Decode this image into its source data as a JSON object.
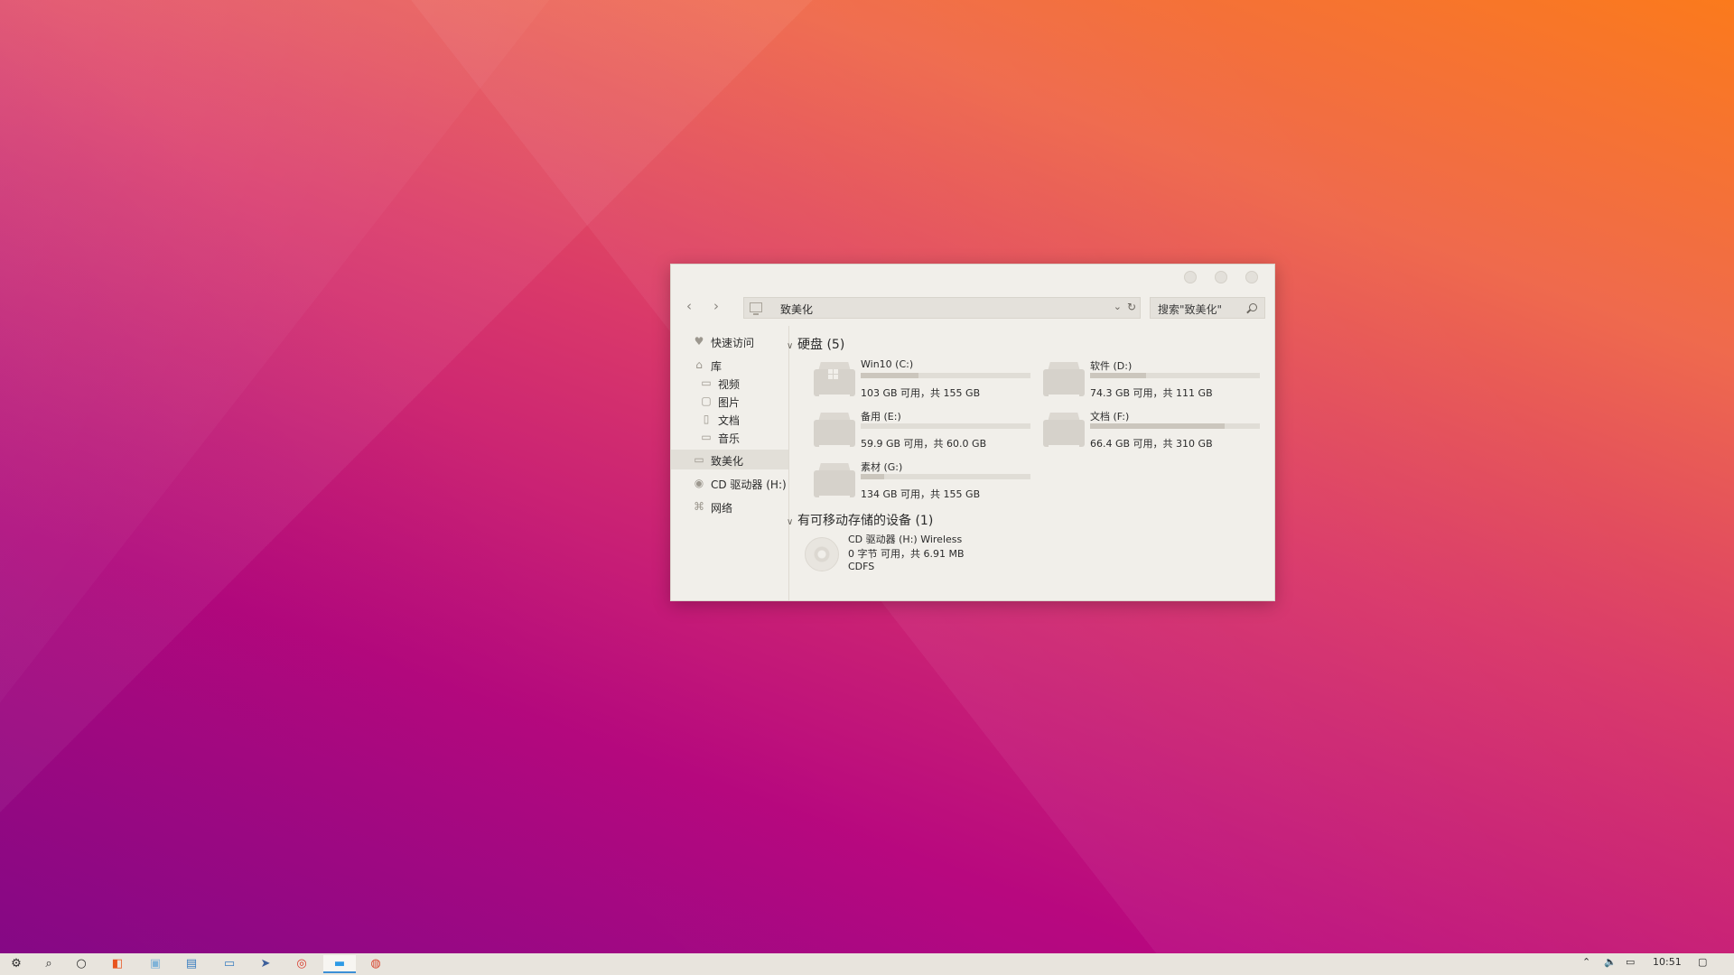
{
  "window": {
    "address_path": "致美化",
    "search_placeholder": "搜索\"致美化\"",
    "sidebar": {
      "quick_access": "快速访问",
      "library": "库",
      "videos": "视频",
      "pictures": "图片",
      "documents": "文档",
      "music": "音乐",
      "this_pc": "致美化",
      "cd_drive": "CD 驱动器 (H:)",
      "network": "网络"
    },
    "hard_disks": {
      "header": "硬盘 (5)",
      "drives": [
        {
          "name": "Win10 (C:)",
          "info": "103 GB 可用，共 155 GB",
          "used_fraction": 0.34
        },
        {
          "name": "软件 (D:)",
          "info": "74.3 GB 可用，共 111 GB",
          "used_fraction": 0.33
        },
        {
          "name": "备用 (E:)",
          "info": "59.9 GB 可用，共 60.0 GB",
          "used_fraction": 0.0
        },
        {
          "name": "文档 (F:)",
          "info": "66.4 GB 可用，共 310 GB",
          "used_fraction": 0.79
        },
        {
          "name": "素材 (G:)",
          "info": "134 GB 可用，共 155 GB",
          "used_fraction": 0.14
        }
      ]
    },
    "removable": {
      "header": "有可移动存储的设备 (1)",
      "device": {
        "name": "CD 驱动器 (H:) Wireless",
        "info": "0 字节 可用，共 6.91 MB",
        "fs": "CDFS"
      }
    }
  },
  "taskbar": {
    "clock": "10:51",
    "icons": [
      "start-icon",
      "search-icon",
      "cortana-icon",
      "office-icon",
      "photoshop-icon",
      "notepad-icon",
      "terminal-icon",
      "telegram-icon",
      "netease-music-icon",
      "file-explorer-icon",
      "chrome-icon"
    ]
  }
}
